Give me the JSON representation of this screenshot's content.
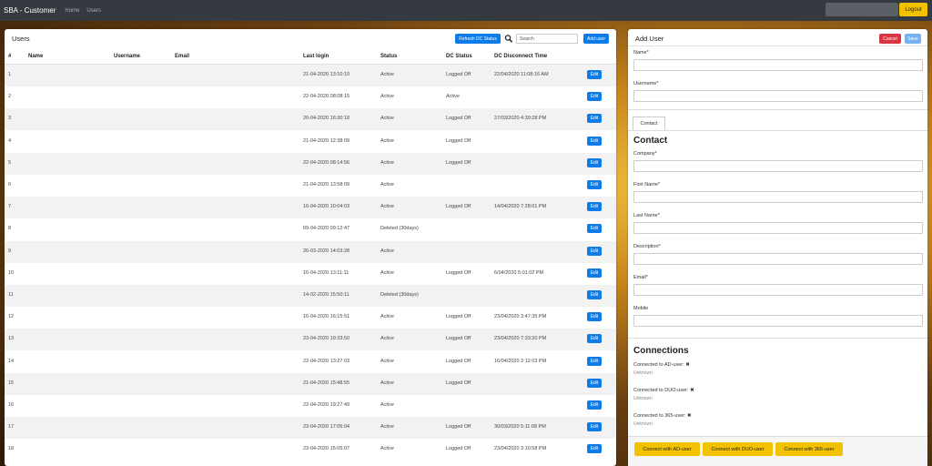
{
  "navbar": {
    "brand": "SBA - Customer",
    "links": [
      "Home",
      "Users"
    ],
    "logout_label": "Logout"
  },
  "users": {
    "title": "Users",
    "refresh_label": "Refresh DC Status",
    "search_placeholder": "Search",
    "add_label": "Add user",
    "columns": [
      "#",
      "Name",
      "Username",
      "Email",
      "Last login",
      "Status",
      "DC Status",
      "DC Disconnect Time",
      ""
    ],
    "edit_label": "Edit",
    "rows": [
      {
        "num": "1",
        "last_login": "21-04-2020 13:10:10",
        "status": "Active",
        "dc_status": "Logged Off",
        "disconnect": "22/04/2020 11:08:16 AM"
      },
      {
        "num": "2",
        "last_login": "22-04-2020 08:08:15",
        "status": "Active",
        "dc_status": "Active",
        "disconnect": ""
      },
      {
        "num": "3",
        "last_login": "20-04-2020 16:30:18",
        "status": "Active",
        "dc_status": "Logged Off",
        "disconnect": "27/03/2020 4:39:28 PM"
      },
      {
        "num": "4",
        "last_login": "21-04-2020 12:38:09",
        "status": "Active",
        "dc_status": "Logged Off",
        "disconnect": ""
      },
      {
        "num": "5",
        "last_login": "22-04-2020 08:14:56",
        "status": "Active",
        "dc_status": "Logged Off",
        "disconnect": ""
      },
      {
        "num": "6",
        "last_login": "21-04-2020 13:58:09",
        "status": "Active",
        "dc_status": "",
        "disconnect": ""
      },
      {
        "num": "7",
        "last_login": "16-04-2020 10:04:03",
        "status": "Active",
        "dc_status": "Logged Off",
        "disconnect": "14/04/2020 7:28:01 PM"
      },
      {
        "num": "8",
        "last_login": "09-04-2020 09:12:47",
        "status": "Deleted (30days)",
        "dc_status": "",
        "disconnect": ""
      },
      {
        "num": "9",
        "last_login": "26-03-2020 14:03:28",
        "status": "Active",
        "dc_status": "",
        "disconnect": ""
      },
      {
        "num": "10",
        "last_login": "16-04-2020 13:11:11",
        "status": "Active",
        "dc_status": "Logged Off",
        "disconnect": "6/04/2020 5:01:02 PM"
      },
      {
        "num": "11",
        "last_login": "14-02-2020 15:50:11",
        "status": "Deleted (30days)",
        "dc_status": "",
        "disconnect": ""
      },
      {
        "num": "12",
        "last_login": "16-04-2020 16:15:51",
        "status": "Active",
        "dc_status": "Logged Off",
        "disconnect": "23/04/2020 3:47:35 PM"
      },
      {
        "num": "13",
        "last_login": "23-04-2020 19:33:50",
        "status": "Active",
        "dc_status": "Logged Off",
        "disconnect": "23/04/2020 7:33:20 PM"
      },
      {
        "num": "14",
        "last_login": "22-04-2020 13:27:03",
        "status": "Active",
        "dc_status": "Logged Off",
        "disconnect": "16/04/2020 2:12:03 PM"
      },
      {
        "num": "15",
        "last_login": "21-04-2020 15:48:55",
        "status": "Active",
        "dc_status": "Logged Off",
        "disconnect": ""
      },
      {
        "num": "16",
        "last_login": "22-04-2020 19:27:49",
        "status": "Active",
        "dc_status": "",
        "disconnect": ""
      },
      {
        "num": "17",
        "last_login": "23-04-2020 17:05:04",
        "status": "Active",
        "dc_status": "Logged Off",
        "disconnect": "30/03/2020 5:11:08 PM"
      },
      {
        "num": "18",
        "last_login": "23-04-2020 15:05:07",
        "status": "Active",
        "dc_status": "Logged Off",
        "disconnect": "23/04/2020 3:10:58 PM"
      }
    ]
  },
  "add_user": {
    "title": "Add User",
    "cancel_label": "Cancel",
    "save_label": "Save",
    "name_label": "Name*",
    "username_label": "Username*",
    "contact_tab": "Contact",
    "contact_heading": "Contact",
    "company_label": "Company*",
    "first_name_label": "First Name*",
    "last_name_label": "Last Name*",
    "description_label": "Description*",
    "email_label": "Email*",
    "mobile_label": "Mobile",
    "connections_heading": "Connections",
    "connections": [
      {
        "label": "Connected to AD-user:",
        "status": "Unknown"
      },
      {
        "label": "Connected to DUO-user:",
        "status": "Unknown"
      },
      {
        "label": "Connected to 365-user:",
        "status": "Unknown"
      }
    ],
    "connect_buttons": [
      "Connect with AD-user",
      "Connect with DUO-user",
      "Connect with 365-user"
    ]
  }
}
